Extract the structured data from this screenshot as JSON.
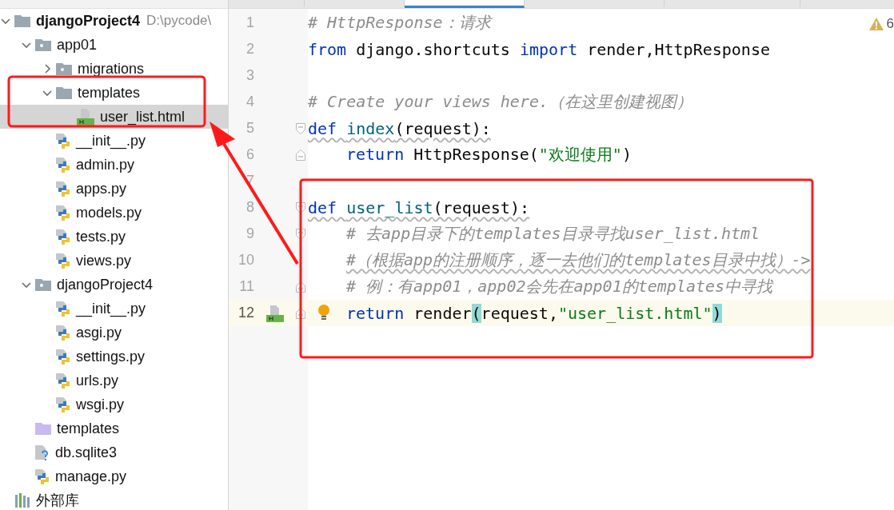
{
  "project_tree": [
    {
      "kind": "root",
      "name": "djangoProject4",
      "path": "D:\\pycode\\",
      "expanded": true,
      "selected": false,
      "children": [
        {
          "kind": "package",
          "name": "app01",
          "expanded": true,
          "selected": false,
          "children": [
            {
              "kind": "package",
              "name": "migrations",
              "expanded": false,
              "selected": false
            },
            {
              "kind": "folder",
              "name": "templates",
              "expanded": true,
              "selected": false,
              "children": [
                {
                  "kind": "html",
                  "name": "user_list.html",
                  "selected": true
                }
              ]
            },
            {
              "kind": "python",
              "name": "__init__.py",
              "selected": false
            },
            {
              "kind": "python",
              "name": "admin.py",
              "selected": false
            },
            {
              "kind": "python",
              "name": "apps.py",
              "selected": false
            },
            {
              "kind": "python",
              "name": "models.py",
              "selected": false
            },
            {
              "kind": "python",
              "name": "tests.py",
              "selected": false
            },
            {
              "kind": "python",
              "name": "views.py",
              "selected": false
            }
          ]
        },
        {
          "kind": "package",
          "name": "djangoProject4",
          "expanded": true,
          "selected": false,
          "children": [
            {
              "kind": "python",
              "name": "__init__.py",
              "selected": false
            },
            {
              "kind": "python",
              "name": "asgi.py",
              "selected": false
            },
            {
              "kind": "python",
              "name": "settings.py",
              "selected": false
            },
            {
              "kind": "python",
              "name": "urls.py",
              "selected": false
            },
            {
              "kind": "python",
              "name": "wsgi.py",
              "selected": false
            }
          ]
        },
        {
          "kind": "template-folder",
          "name": "templates",
          "selected": false
        },
        {
          "kind": "unknown-file",
          "name": "db.sqlite3",
          "selected": false
        },
        {
          "kind": "python",
          "name": "manage.py",
          "selected": false
        }
      ]
    },
    {
      "kind": "library",
      "name": "外部库",
      "selected": false
    }
  ],
  "editor_tabs": [
    {
      "selected": false
    },
    {
      "selected": false
    },
    {
      "selected": true
    },
    {
      "selected": false
    },
    {
      "selected": false
    },
    {
      "selected": false
    }
  ],
  "inspections": {
    "warnings": "6"
  },
  "code_lines": [
    {
      "number": "1",
      "current": false,
      "tokens": [
        {
          "kind": "comment",
          "text": "# HttpResponse：请求"
        }
      ]
    },
    {
      "number": "2",
      "current": false,
      "tokens": [
        {
          "kind": "keyword",
          "text": "from"
        },
        {
          "kind": "plain",
          "text": " django.shortcuts "
        },
        {
          "kind": "keyword",
          "text": "import"
        },
        {
          "kind": "plain",
          "text": " render,HttpResponse"
        }
      ]
    },
    {
      "number": "3",
      "current": false
    },
    {
      "number": "4",
      "current": false,
      "tokens": [
        {
          "kind": "comment",
          "text": "# Create your views here.（在这里创建视图）"
        }
      ]
    },
    {
      "number": "5",
      "current": false,
      "fold_start": true,
      "warning_underline": true,
      "tokens": [
        {
          "kind": "keyword",
          "text": "def "
        },
        {
          "kind": "function",
          "text": "index"
        },
        {
          "kind": "plain",
          "text": "(request):"
        }
      ]
    },
    {
      "number": "6",
      "current": false,
      "fold_end": true,
      "indented": true,
      "tokens": [
        {
          "kind": "keyword",
          "text": "return"
        },
        {
          "kind": "plain",
          "text": " HttpResponse("
        },
        {
          "kind": "string",
          "text": "\"欢迎使用\""
        },
        {
          "kind": "plain",
          "text": ")"
        }
      ]
    },
    {
      "number": "7",
      "current": false
    },
    {
      "number": "8",
      "current": false,
      "fold_start": true,
      "warning_underline": true,
      "tokens": [
        {
          "kind": "keyword",
          "text": "def "
        },
        {
          "kind": "function",
          "text": "user_list"
        },
        {
          "kind": "plain",
          "text": "(request):"
        }
      ]
    },
    {
      "number": "9",
      "current": false,
      "fold_start": true,
      "indented": true,
      "tokens": [
        {
          "kind": "comment",
          "text": "# 去app目录下的templates目录寻找user_list.html"
        }
      ]
    },
    {
      "number": "10",
      "current": false,
      "indented": true,
      "warning_underline": true,
      "tokens": [
        {
          "kind": "comment",
          "text": "#（根据app的注册顺序，逐一去他们的templates目录中找）->"
        }
      ]
    },
    {
      "number": "11",
      "current": false,
      "fold_end": true,
      "indented": true,
      "tokens": [
        {
          "kind": "comment",
          "text": "# 例：有app01，app02会先在app01的templates中寻找"
        }
      ]
    },
    {
      "number": "12",
      "current": true,
      "fold_end": true,
      "gutter_html_icon": true,
      "intention": true,
      "indented": true,
      "tokens": [
        {
          "kind": "keyword",
          "text": "return"
        },
        {
          "kind": "plain",
          "text": " render"
        },
        {
          "kind": "bracket",
          "text": "("
        },
        {
          "kind": "plain",
          "text": "request,"
        },
        {
          "kind": "string",
          "text": "\"user_list.html\""
        },
        {
          "kind": "bracket",
          "text": ")"
        }
      ]
    }
  ]
}
